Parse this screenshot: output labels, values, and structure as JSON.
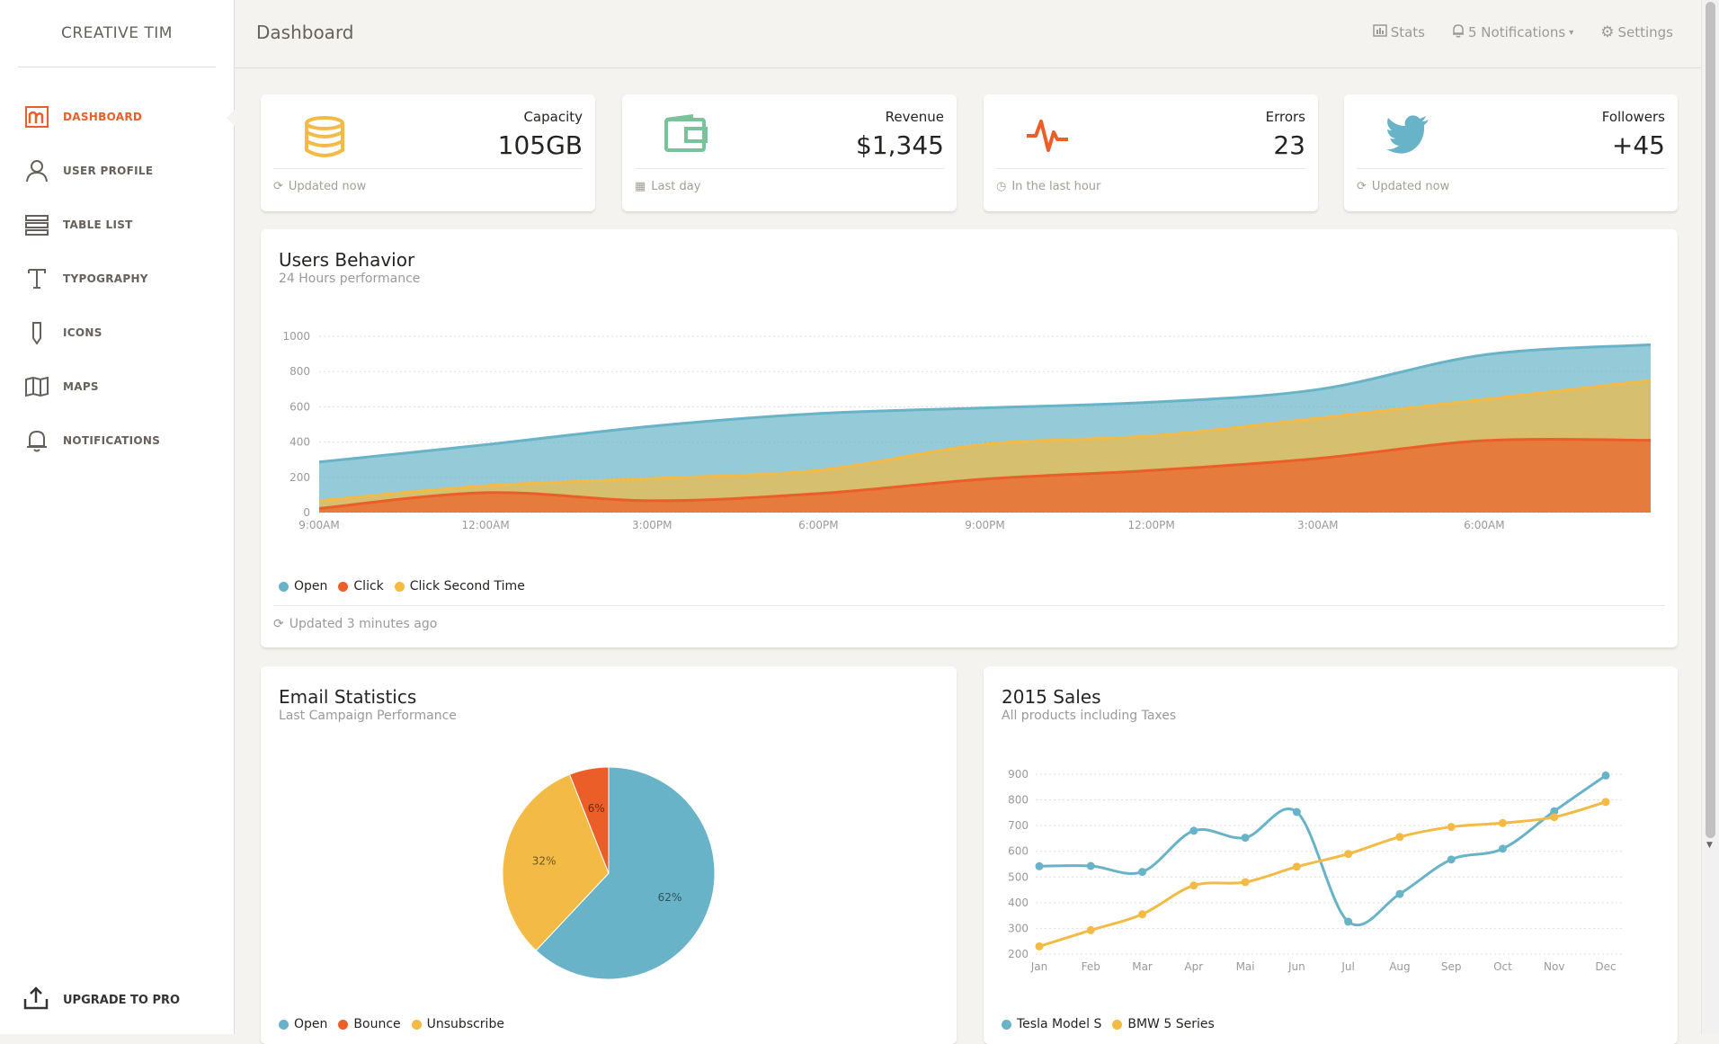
{
  "brand": "CREATIVE TIM",
  "sidebar": {
    "items": [
      {
        "label": "DASHBOARD",
        "icon": "dashboard-icon"
      },
      {
        "label": "USER PROFILE",
        "icon": "user-icon"
      },
      {
        "label": "TABLE LIST",
        "icon": "list-icon"
      },
      {
        "label": "TYPOGRAPHY",
        "icon": "text-icon"
      },
      {
        "label": "ICONS",
        "icon": "pencil-icon"
      },
      {
        "label": "MAPS",
        "icon": "map-icon"
      },
      {
        "label": "NOTIFICATIONS",
        "icon": "bell-icon"
      }
    ],
    "upgrade": "UPGRADE TO PRO"
  },
  "topbar": {
    "title": "Dashboard",
    "stats": "Stats",
    "notifications": "5 Notifications",
    "settings": "Settings"
  },
  "stats": [
    {
      "category": "Capacity",
      "value": "105GB",
      "footer": "Updated now",
      "icon": "server-icon",
      "color": "#f3bb45"
    },
    {
      "category": "Revenue",
      "value": "$1,345",
      "footer": "Last day",
      "icon": "wallet-icon",
      "color": "#7ac29a"
    },
    {
      "category": "Errors",
      "value": "23",
      "footer": "In the last hour",
      "icon": "pulse-icon",
      "color": "#eb5e28"
    },
    {
      "category": "Followers",
      "value": "+45",
      "footer": "Updated now",
      "icon": "twitter-icon",
      "color": "#68b3c8"
    }
  ],
  "users_behavior": {
    "title": "Users Behavior",
    "subtitle": "24 Hours performance",
    "footer": "Updated 3 minutes ago",
    "legend": [
      "Open",
      "Click",
      "Click Second Time"
    ]
  },
  "email_stats": {
    "title": "Email Statistics",
    "subtitle": "Last Campaign Performance",
    "legend": [
      "Open",
      "Bounce",
      "Unsubscribe"
    ]
  },
  "sales": {
    "title": "2015 Sales",
    "subtitle": "All products including Taxes",
    "legend": [
      "Tesla Model S",
      "BMW 5 Series"
    ]
  },
  "colors": {
    "blue": "#68b3c8",
    "orange": "#eb5e28",
    "yellow": "#f3bb45",
    "green": "#7ac29a"
  },
  "chart_data": [
    {
      "type": "area",
      "title": "Users Behavior",
      "x": [
        "9:00AM",
        "12:00AM",
        "3:00PM",
        "6:00PM",
        "9:00PM",
        "12:00PM",
        "3:00AM",
        "6:00AM"
      ],
      "ylim": [
        0,
        1000
      ],
      "yticks": [
        0,
        200,
        400,
        600,
        800,
        1000
      ],
      "series": [
        {
          "name": "Open",
          "values": [
            287,
            385,
            490,
            562,
            594,
            626,
            698,
            895,
            952
          ],
          "color": "#68b3c8"
        },
        {
          "name": "Click Second Time",
          "values": [
            67,
            152,
            193,
            240,
            387,
            435,
            535,
            642,
            750
          ],
          "color": "#f3bb45"
        },
        {
          "name": "Click",
          "values": [
            23,
            113,
            67,
            108,
            190,
            239,
            307,
            408,
            410
          ],
          "color": "#eb5e28"
        }
      ],
      "legend": "bottom-left"
    },
    {
      "type": "pie",
      "title": "Email Statistics",
      "categories": [
        "Open",
        "Unsubscribe",
        "Bounce"
      ],
      "values": [
        62,
        32,
        6
      ],
      "labels": [
        "62%",
        "32%",
        "6%"
      ],
      "colors": [
        "#68b3c8",
        "#f3bb45",
        "#eb5e28"
      ]
    },
    {
      "type": "line",
      "title": "2015 Sales",
      "categories": [
        "Jan",
        "Feb",
        "Mar",
        "Apr",
        "Mai",
        "Jun",
        "Jul",
        "Aug",
        "Sep",
        "Oct",
        "Nov",
        "Dec"
      ],
      "ylim": [
        200,
        900
      ],
      "yticks": [
        200,
        300,
        400,
        500,
        600,
        700,
        800,
        900
      ],
      "series": [
        {
          "name": "Tesla Model S",
          "values": [
            542,
            543,
            520,
            680,
            653,
            753,
            326,
            434,
            568,
            610,
            756,
            895
          ],
          "color": "#68b3c8"
        },
        {
          "name": "BMW 5 Series",
          "values": [
            230,
            293,
            355,
            467,
            480,
            540,
            590,
            656,
            695,
            710,
            733,
            792
          ],
          "color": "#f3bb45"
        }
      ]
    }
  ]
}
